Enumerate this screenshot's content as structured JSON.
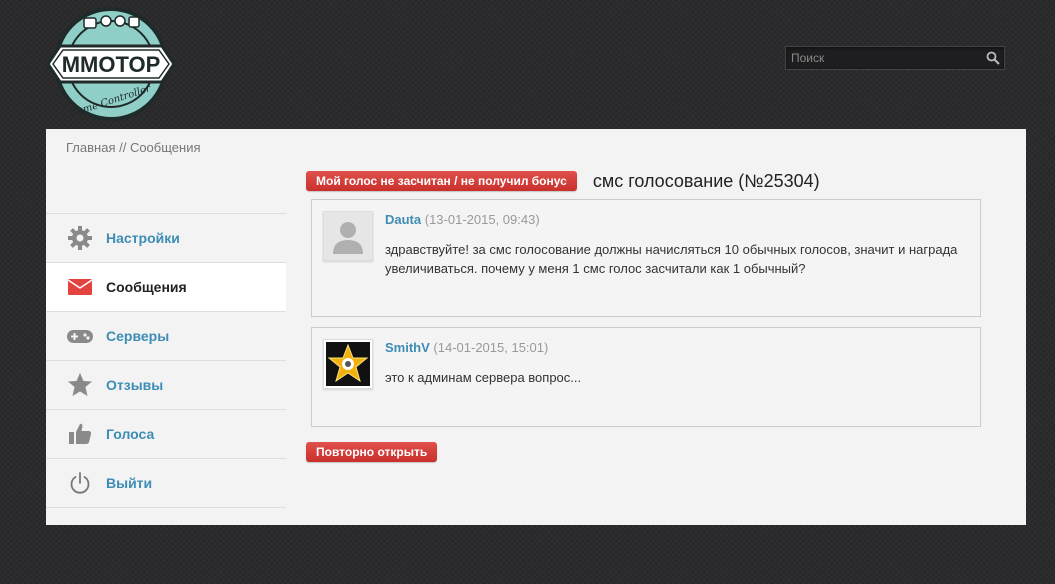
{
  "logo": {
    "text": "MMOTOP",
    "subtitle": "Game Controller"
  },
  "search": {
    "placeholder": "Поиск"
  },
  "breadcrumb": {
    "home": "Главная",
    "separator": " // ",
    "current": "Сообщения"
  },
  "sidebar": {
    "items": [
      {
        "label": "Настройки",
        "icon": "gear-icon",
        "active": false
      },
      {
        "label": "Сообщения",
        "icon": "envelope-icon",
        "active": true
      },
      {
        "label": "Серверы",
        "icon": "gamepad-icon",
        "active": false
      },
      {
        "label": "Отзывы",
        "icon": "star-icon",
        "active": false
      },
      {
        "label": "Голоса",
        "icon": "thumbs-up-icon",
        "active": false
      },
      {
        "label": "Выйти",
        "icon": "power-icon",
        "active": false
      }
    ]
  },
  "topic": {
    "tag_button": "Мой голос не засчитан / не получил бонус",
    "title": "смс голосование (№25304)"
  },
  "messages": [
    {
      "author": "Dauta",
      "date": "(13-01-2015, 09:43)",
      "text": "здравствуйте! за смс голосование должны начисляться 10 обычных голосов, значит и награда увеличиваться. почему у меня 1 смс голос засчитали как 1 обычный?",
      "avatar": "default-avatar-icon"
    },
    {
      "author": "SmithV",
      "date": "(14-01-2015, 15:01)",
      "text": "это к админам сервера вопрос...",
      "avatar": "star-avatar-icon"
    }
  ],
  "actions": {
    "reopen": "Повторно открыть"
  },
  "colors": {
    "accent_red": "#d9403c",
    "link_blue": "#3d8db5",
    "logo_teal": "#8fcfc8"
  }
}
